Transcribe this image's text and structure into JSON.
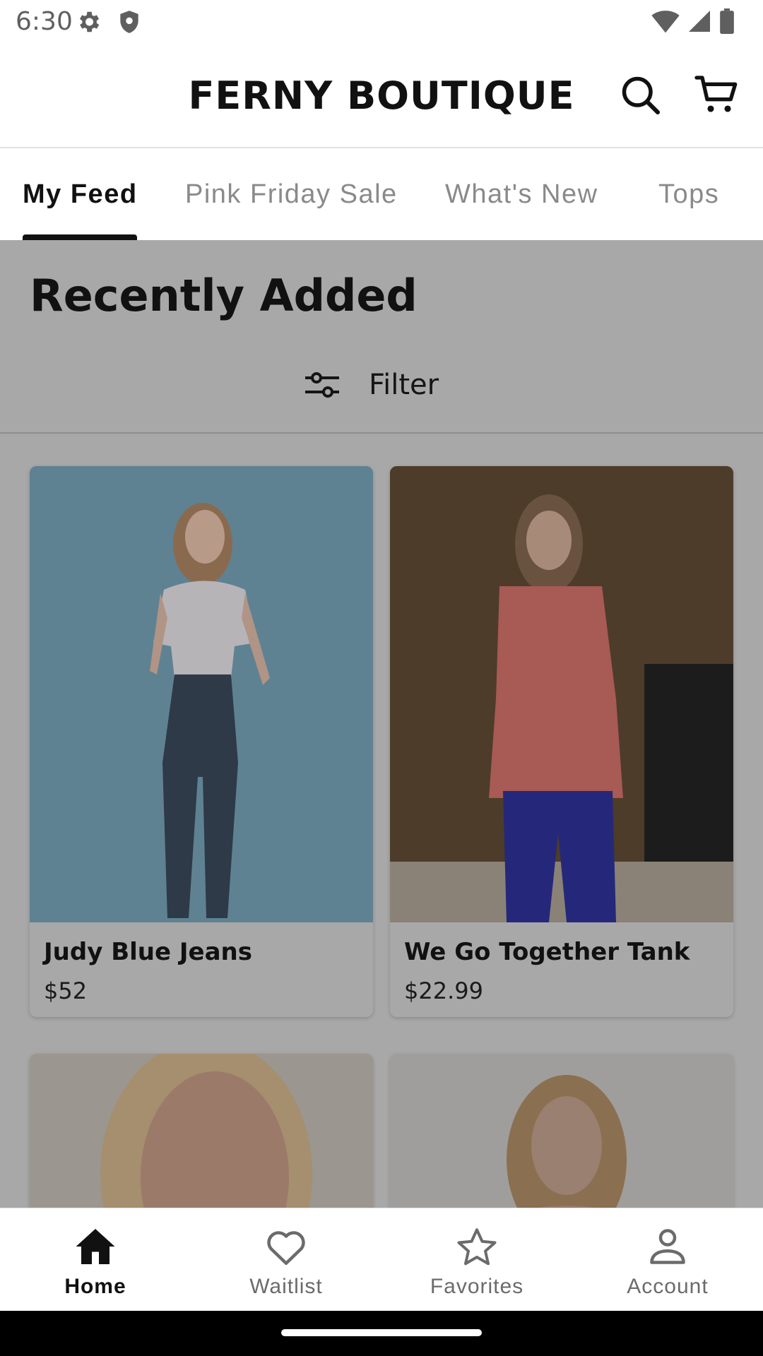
{
  "status_bar": {
    "time": "6:30"
  },
  "header": {
    "brand": "FERNY BOUTIQUE"
  },
  "tabs": [
    {
      "label": "My Feed",
      "active": true
    },
    {
      "label": "Pink Friday Sale",
      "active": false
    },
    {
      "label": "What's New",
      "active": false
    },
    {
      "label": "Tops",
      "active": false
    }
  ],
  "section": {
    "title": "Recently Added",
    "filter_label": "Filter"
  },
  "products": [
    {
      "name": "Judy Blue Jeans",
      "price": "$52"
    },
    {
      "name": "We Go Together Tank",
      "price": "$22.99"
    }
  ],
  "bottom_nav": [
    {
      "label": "Home",
      "icon": "home-icon",
      "active": true
    },
    {
      "label": "Waitlist",
      "icon": "heart-icon",
      "active": false
    },
    {
      "label": "Favorites",
      "icon": "star-icon",
      "active": false
    },
    {
      "label": "Account",
      "icon": "account-icon",
      "active": false
    }
  ],
  "colors": {
    "overlay": "#a8a8a8",
    "active_text": "#111111",
    "inactive_text": "#8a8a8a"
  }
}
